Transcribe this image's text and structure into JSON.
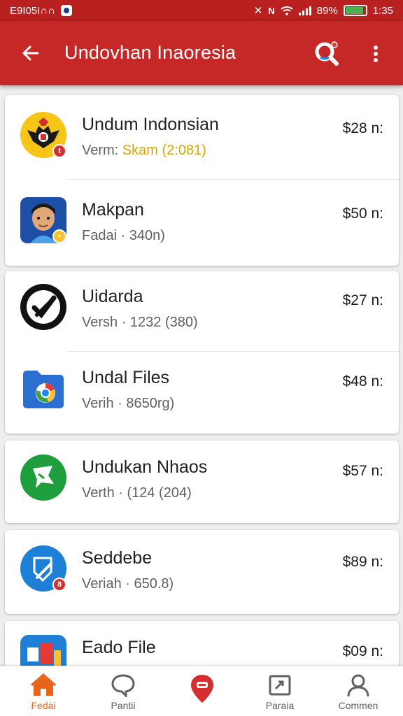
{
  "status_bar": {
    "left_text": "E9I05I∩∩",
    "battery": "89%",
    "time": "1:35",
    "battery_level": 0.89
  },
  "app_bar": {
    "title": "Undovhan Inaoresia"
  },
  "apps": [
    {
      "name": "Undum Indonsian",
      "sub_prefix": "Verm: ",
      "sub_highlight": "Skam (2:081)",
      "price": "$28 n:",
      "icon": "garuda-icon",
      "badge_color": "#d32f2f"
    },
    {
      "name": "Makpan",
      "sub_prefix": "Fadai · 340n)",
      "sub_highlight": "",
      "price": "$50 n:",
      "icon": "avatar-icon",
      "badge_color": "#fbc02d"
    },
    {
      "name": "Uidarda",
      "sub_prefix": "Versh · 1232 (380)",
      "sub_highlight": "",
      "price": "$27 n:",
      "icon": "check-icon"
    },
    {
      "name": "Undal Files",
      "sub_prefix": "Verih · 8650rg)",
      "sub_highlight": "",
      "price": "$48 n:",
      "icon": "folder-icon"
    },
    {
      "name": "Undukan Nhaos",
      "sub_prefix": "Verth · (124 (204)",
      "sub_highlight": "",
      "price": "$57 n:",
      "icon": "chat-icon"
    },
    {
      "name": "Seddebe",
      "sub_prefix": "Veriah · 650.8)",
      "sub_highlight": "",
      "price": "$89 n:",
      "icon": "edit-icon",
      "badge_color": "#d32f2f",
      "badge_text": "8"
    },
    {
      "name": "Eado File",
      "sub_prefix": "",
      "sub_highlight": "",
      "price": "$09 n:",
      "icon": "files-icon"
    }
  ],
  "bottom_nav": [
    {
      "label": "Fedai",
      "icon": "home-icon",
      "active": true
    },
    {
      "label": "Pantii",
      "icon": "chat-bubble-icon",
      "active": false
    },
    {
      "label": "",
      "icon": "pin-icon",
      "active": false
    },
    {
      "label": "Paraia",
      "icon": "chart-icon",
      "active": false
    },
    {
      "label": "Commen",
      "icon": "person-icon",
      "active": false
    }
  ],
  "colors": {
    "app_bar": "#c62828",
    "status_bar": "#b8211f",
    "accent": "#e8641b",
    "highlight": "#d4a800"
  }
}
